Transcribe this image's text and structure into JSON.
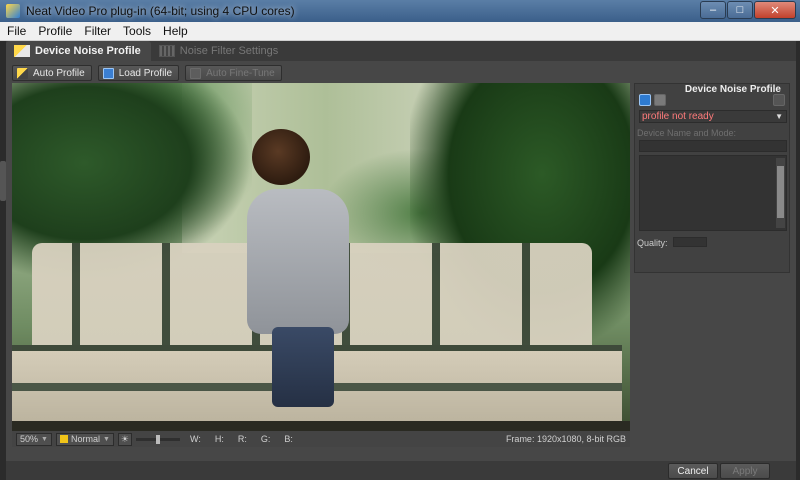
{
  "window": {
    "title": "Neat Video Pro plug-in (64-bit; using 4 CPU cores)",
    "minimize": "–",
    "maximize": "□",
    "close": "✕"
  },
  "menu": [
    "File",
    "Profile",
    "Filter",
    "Tools",
    "Help"
  ],
  "tabs": [
    {
      "label": "Device Noise Profile",
      "active": true
    },
    {
      "label": "Noise Filter Settings",
      "active": false
    }
  ],
  "toolbar": {
    "auto_profile": "Auto Profile",
    "load_profile": "Load Profile",
    "auto_fine_tune": "Auto Fine-Tune"
  },
  "status": {
    "zoom": "50%",
    "mode": "Normal",
    "w_label": "W:",
    "h_label": "H:",
    "r_label": "R:",
    "g_label": "G:",
    "b_label": "B:",
    "frame_info": "Frame: 1920x1080, 8-bit RGB"
  },
  "side_panel": {
    "title": "Device Noise Profile",
    "profile_status": "profile not ready",
    "device_name_label": "Device Name and Mode:",
    "quality_label": "Quality:"
  },
  "buttons": {
    "cancel": "Cancel",
    "apply": "Apply"
  },
  "colors": {
    "profile_status": "#ff7b7b",
    "accent": "#2e7bd1"
  }
}
